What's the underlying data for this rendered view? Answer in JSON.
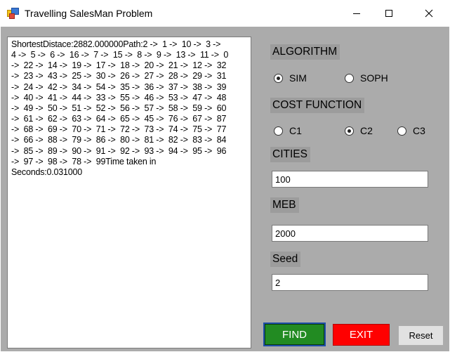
{
  "window": {
    "title": "Travelling SalesMan Problem",
    "icon": "app-window-icon",
    "controls": {
      "minimize": "minimize-icon",
      "maximize": "maximize-icon",
      "close": "close-icon"
    }
  },
  "output": {
    "lines": [
      "ShortestDistace:2882.000000Path:2 ->  1 ->  10 ->  3 ->",
      "4 ->  5 ->  6 ->  16 ->  7 ->  15 ->  8 ->  9 ->  13 ->  11 ->  0",
      "->  22 ->  14 ->  19 ->  17 ->  18 ->  20 ->  21 ->  12 ->  32",
      "->  23 ->  43 ->  25 ->  30 ->  26 ->  27 ->  28 ->  29 ->  31",
      "->  24 ->  42 ->  34 ->  54 ->  35 ->  36 ->  37 ->  38 ->  39",
      "->  40 ->  41 ->  44 ->  33 ->  55 ->  46 ->  53 ->  47 ->  48",
      "->  49 ->  50 ->  51 ->  52 ->  56 ->  57 ->  58 ->  59 ->  60",
      "->  61 ->  62 ->  63 ->  64 ->  65 ->  45 ->  76 ->  67 ->  87",
      "->  68 ->  69 ->  70 ->  71 ->  72 ->  73 ->  74 ->  75 ->  77",
      "->  66 ->  88 ->  79 ->  86 ->  80 ->  81 ->  82 ->  83 ->  84",
      "->  85 ->  89 ->  90 ->  91 ->  92 ->  93 ->  94 ->  95 ->  96",
      "->  97 ->  98 ->  78 ->  99Time taken in",
      "Seconds:0.031000"
    ]
  },
  "algorithm": {
    "label": "ALGORITHM",
    "options": [
      {
        "label": "SIM",
        "checked": true
      },
      {
        "label": "SOPH",
        "checked": false
      }
    ]
  },
  "cost_function": {
    "label": "COST FUNCTION",
    "options": [
      {
        "label": "C1",
        "checked": false
      },
      {
        "label": "C2",
        "checked": true
      },
      {
        "label": "C3",
        "checked": false
      }
    ]
  },
  "cities": {
    "label": "CITIES",
    "value": "100"
  },
  "meb": {
    "label": "MEB",
    "value": "2000"
  },
  "seed": {
    "label": "Seed",
    "value": "2"
  },
  "buttons": {
    "find": {
      "label": "FIND",
      "bg": "#228b22"
    },
    "exit": {
      "label": "EXIT",
      "bg": "#ff0000"
    },
    "reset": {
      "label": "Reset",
      "bg": "#e1e1e1"
    }
  }
}
